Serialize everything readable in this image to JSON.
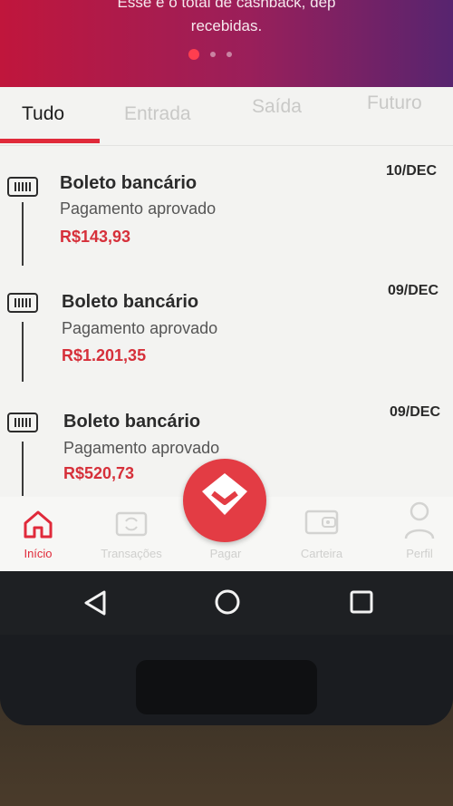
{
  "banner": {
    "line1": "Esse é o total de cashback, dep",
    "line2": "recebidas."
  },
  "tabs": [
    {
      "label": "Tudo",
      "active": true
    },
    {
      "label": "Entrada"
    },
    {
      "label": "Saída"
    },
    {
      "label": "Futuro"
    }
  ],
  "transactions": [
    {
      "title": "Boleto bancário",
      "status": "Pagamento aprovado",
      "amount": "R$143,93",
      "date": "10/DEC",
      "icon": "barcode-icon"
    },
    {
      "title": "Boleto bancário",
      "status": "Pagamento aprovado",
      "amount": "R$1.201,35",
      "date": "09/DEC",
      "icon": "barcode-icon"
    },
    {
      "title": "Boleto bancário",
      "status": "Pagamento aprovado",
      "amount": "R$520,73",
      "date": "09/DEC",
      "icon": "barcode-icon"
    }
  ],
  "bottom_nav": {
    "items": [
      {
        "label": "Início",
        "icon": "home-icon",
        "active": true
      },
      {
        "label": "Transações",
        "icon": "transactions-icon"
      },
      {
        "label": "Pagar",
        "icon": "heart-icon"
      },
      {
        "label": "Carteira",
        "icon": "wallet-icon"
      },
      {
        "label": "Perfil",
        "icon": "profile-icon"
      }
    ]
  },
  "colors": {
    "accent": "#e02a3a",
    "banner_start": "#c0163c",
    "banner_end": "#57246f"
  }
}
